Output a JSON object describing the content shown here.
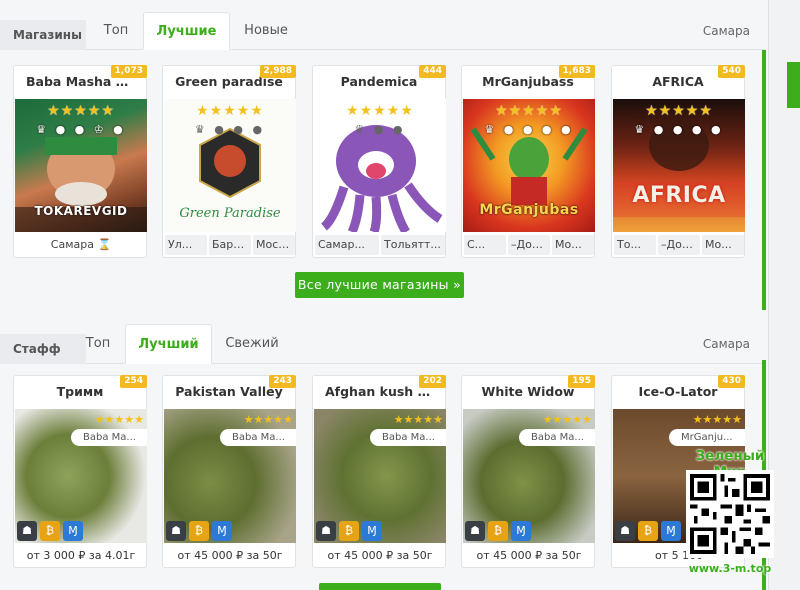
{
  "shops": {
    "section_label": "Магазины",
    "tabs": [
      "Топ",
      "Лучшие",
      "Новые"
    ],
    "active_tab": 1,
    "city": "Самара",
    "cards": [
      {
        "name": "Baba Masha T...",
        "count": "1,073",
        "image_caption": "TOKAREVGID",
        "tags": [
          "Самара ⌛"
        ]
      },
      {
        "name": "Green paradise",
        "count": "2,988",
        "image_caption": "Green Paradise",
        "tags": [
          "Ул...",
          "Барн...",
          "Москв..."
        ]
      },
      {
        "name": "Pandemica",
        "count": "444",
        "image_caption": "",
        "tags": [
          "Самар...",
          "Тольятт..."
        ]
      },
      {
        "name": "MrGanjubass",
        "count": "1,683",
        "image_caption": "MrGanjubas",
        "tags": [
          "С...",
          "–Достав...",
          "Мо..."
        ]
      },
      {
        "name": "AFRICA",
        "count": "540",
        "image_caption": "AFRICA",
        "tags": [
          "То...",
          "–Доста...",
          "Мо..."
        ]
      }
    ],
    "all_best_button": "Все лучшие магазины »"
  },
  "staff": {
    "section_label": "Стафф",
    "tabs": [
      "Топ",
      "Лучший",
      "Свежий"
    ],
    "active_tab": 1,
    "city": "Самара",
    "cards": [
      {
        "name": "Тримм",
        "count": "254",
        "shop": "Baba Ma...",
        "price": "от 3 000 ₽ за 4.01г"
      },
      {
        "name": "Pakistan Valley",
        "count": "243",
        "shop": "Baba Ma...",
        "price": "от 45 000 ₽ за 50г"
      },
      {
        "name": "Afghan kush r...",
        "count": "202",
        "shop": "Baba Ma...",
        "price": "от 45 000 ₽ за 50г"
      },
      {
        "name": "White Widow",
        "count": "195",
        "shop": "Baba Ma...",
        "price": "от 45 000 ₽ за 50г"
      },
      {
        "name": "Ice-O-Lator",
        "count": "430",
        "shop": "MrGanju...",
        "price": "от 5 100"
      }
    ]
  },
  "watermark": {
    "title": "Зеленый Мир",
    "url": "www.3-m.top"
  },
  "icons": {
    "star": "star-icon",
    "crown": "crown-icon",
    "bitcoin": "bitcoin-icon",
    "monero": "monero-icon",
    "hourglass": "hourglass-icon",
    "courier": "courier-icon"
  },
  "colors": {
    "accent": "#3cae1c",
    "badge": "#f3b920",
    "star": "#f3c11c"
  }
}
